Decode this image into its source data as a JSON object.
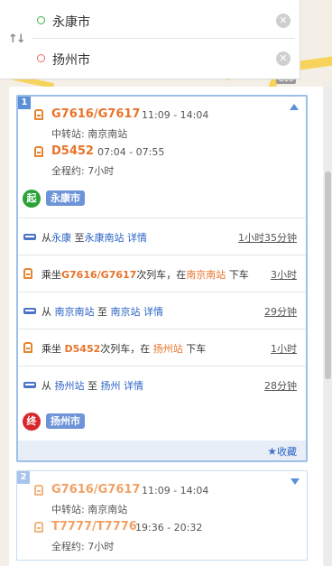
{
  "search": {
    "from": "永康市",
    "to": "扬州市"
  },
  "map": {
    "shield": "G10"
  },
  "plans": [
    {
      "num": "1",
      "legs": [
        {
          "train": "G7616/G7617",
          "time": "11:09 - 14:04"
        },
        {
          "train": "D5452",
          "time": "07:04 - 07:55"
        }
      ],
      "transfer": "中转站: 南京南站",
      "total": "全程约: 7小时",
      "start_badge": "起",
      "start_name": "永康市",
      "steps": [
        {
          "type": "bus",
          "p1": "从",
          "a": "永康",
          "p2": "至",
          "b": "永康南站",
          "detail": "详情",
          "dur": "1小时35分钟"
        },
        {
          "type": "train",
          "p1": "乘坐",
          "train": "G7616/G7617",
          "p2": "次列车，在",
          "station": "南京南站",
          "p3": "下车",
          "dur": "3小时"
        },
        {
          "type": "bus",
          "p1": "从",
          "a": "南京南站",
          "p2": "至",
          "b": "南京站",
          "detail": "详情",
          "dur": "29分钟"
        },
        {
          "type": "train",
          "p1": "乘坐",
          "train": "D5452",
          "p2": "次列车，在",
          "station": "扬州站",
          "p3": "下车",
          "dur": "1小时"
        },
        {
          "type": "bus",
          "p1": "从",
          "a": "扬州站",
          "p2": "至",
          "b": "扬州",
          "detail": "详情",
          "dur": "28分钟"
        }
      ],
      "end_badge": "终",
      "end_name": "扬州市",
      "favorite": "收藏"
    },
    {
      "num": "2",
      "legs": [
        {
          "train": "G7616/G7617",
          "time": "11:09 - 14:04"
        },
        {
          "train": "T7777/T7776",
          "time": "19:36 - 20:32"
        }
      ],
      "transfer": "中转站: 南京南站",
      "total": "全程约: 7小时"
    }
  ],
  "colors": {
    "accent": "#2a63c4",
    "train": "#e8732a",
    "start": "#2aa236",
    "end": "#d8262b"
  }
}
